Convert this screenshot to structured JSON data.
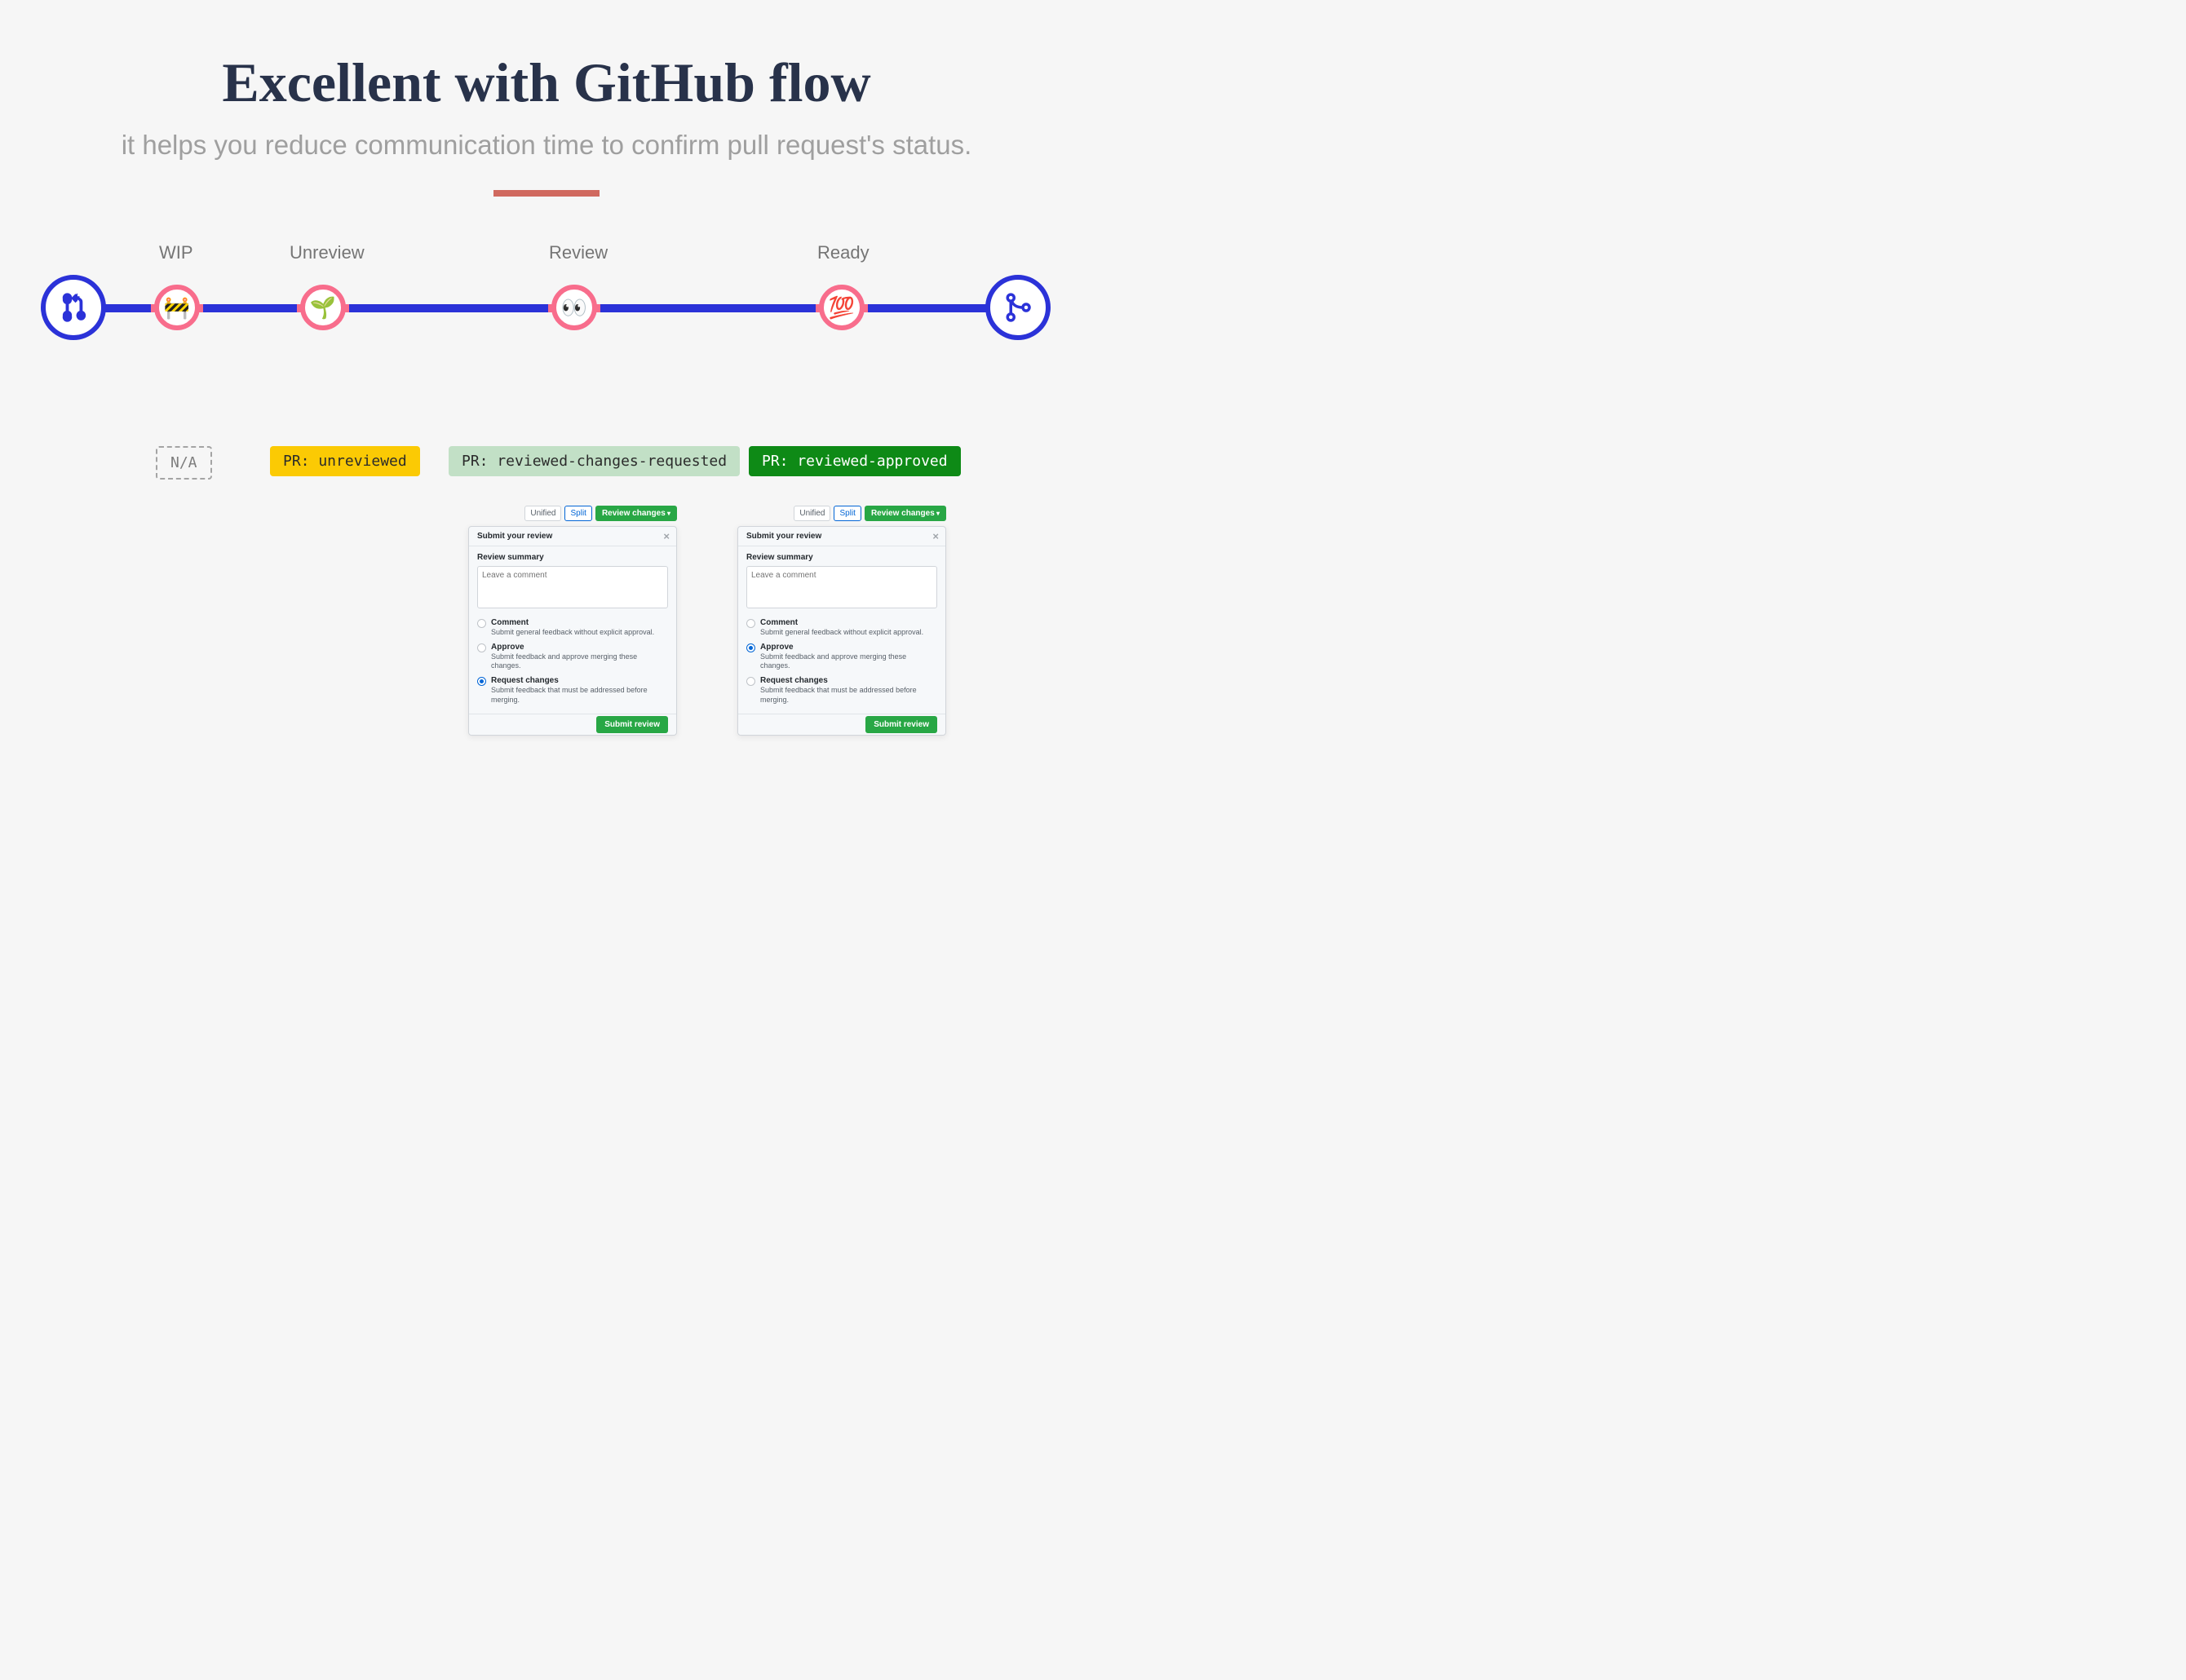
{
  "heading": "Excellent with GitHub flow",
  "subheading": "it helps you reduce communication time to confirm pull request's status.",
  "flow": {
    "stages": [
      {
        "label": "WIP",
        "emoji": "🚧",
        "badge_text": "N/A",
        "badge_class": "na"
      },
      {
        "label": "Unreview",
        "emoji": "🌱",
        "badge_text": "PR: unreviewed",
        "badge_class": "unreviewed"
      },
      {
        "label": "Review",
        "emoji": "👀",
        "badge_text": "PR: reviewed-changes-requested",
        "badge_class": "changes"
      },
      {
        "label": "Ready",
        "emoji": "💯",
        "badge_text": "PR: reviewed-approved",
        "badge_class": "approved"
      }
    ]
  },
  "colors": {
    "accent_blue": "#2b32d8",
    "pink": "#f86d8c",
    "divider": "#d0695f"
  },
  "review_panel": {
    "tabs": {
      "unified": "Unified",
      "split": "Split",
      "review_changes": "Review changes"
    },
    "title": "Submit your review",
    "summary_label": "Review summary",
    "placeholder": "Leave a comment",
    "options": {
      "comment": {
        "title": "Comment",
        "desc": "Submit general feedback without explicit approval."
      },
      "approve": {
        "title": "Approve",
        "desc": "Submit feedback and approve merging these changes."
      },
      "request": {
        "title": "Request changes",
        "desc": "Submit feedback that must be addressed before merging."
      }
    },
    "submit": "Submit review"
  },
  "panels": [
    {
      "selected": "request"
    },
    {
      "selected": "approve"
    }
  ]
}
